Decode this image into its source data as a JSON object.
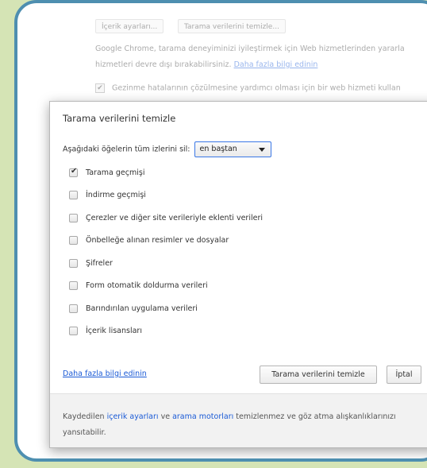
{
  "background": {
    "buttons": [
      "İçerik ayarları...",
      "Tarama verilerini temizle..."
    ],
    "text_line1": "Google Chrome, tarama deneyiminizi iyileştirmek için Web hizmetlerinden yararla",
    "text_line2": "hizmetleri devre dışı bırakabilirsiniz.",
    "text_line2_link": "Daha fazla bilgi edinin",
    "checkbox_label": "Gezinme hatalarının çözülmesine yardımcı olması için bir web hizmeti kullan"
  },
  "dialog": {
    "title": "Tarama verilerini temizle",
    "close": "×",
    "period_label": "Aşağıdaki öğelerin tüm izlerini sil:",
    "period_value": "en baştan",
    "options": [
      {
        "label": "Tarama geçmişi",
        "checked": true
      },
      {
        "label": "İndirme geçmişi",
        "checked": false
      },
      {
        "label": "Çerezler ve diğer site verileriyle eklenti verileri",
        "checked": false
      },
      {
        "label": "Önbelleğe alınan resimler ve dosyalar",
        "checked": false
      },
      {
        "label": "Şifreler",
        "checked": false
      },
      {
        "label": "Form otomatik doldurma verileri",
        "checked": false
      },
      {
        "label": "Barındırılan uygulama verileri",
        "checked": false
      },
      {
        "label": "İçerik lisansları",
        "checked": false
      }
    ],
    "more_info_link": "Daha fazla bilgi edinin",
    "clear_button": "Tarama verilerini temizle",
    "cancel_button": "İptal",
    "footer": {
      "prefix": "Kaydedilen",
      "link1": "içerik ayarları",
      "middle": "ve",
      "link2": "arama motorları",
      "suffix": "temizlenmez ve göz atma alışkanlıklarınızı yansıtabilir."
    }
  }
}
